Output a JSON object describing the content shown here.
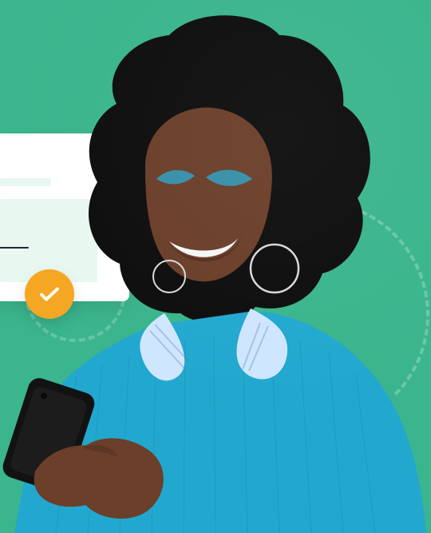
{
  "scene": {
    "background_color": "#3bb58d",
    "accent_orange": "#f5a623",
    "card_tint": "#e9f7f1"
  },
  "icons": {
    "check": "check-icon"
  }
}
